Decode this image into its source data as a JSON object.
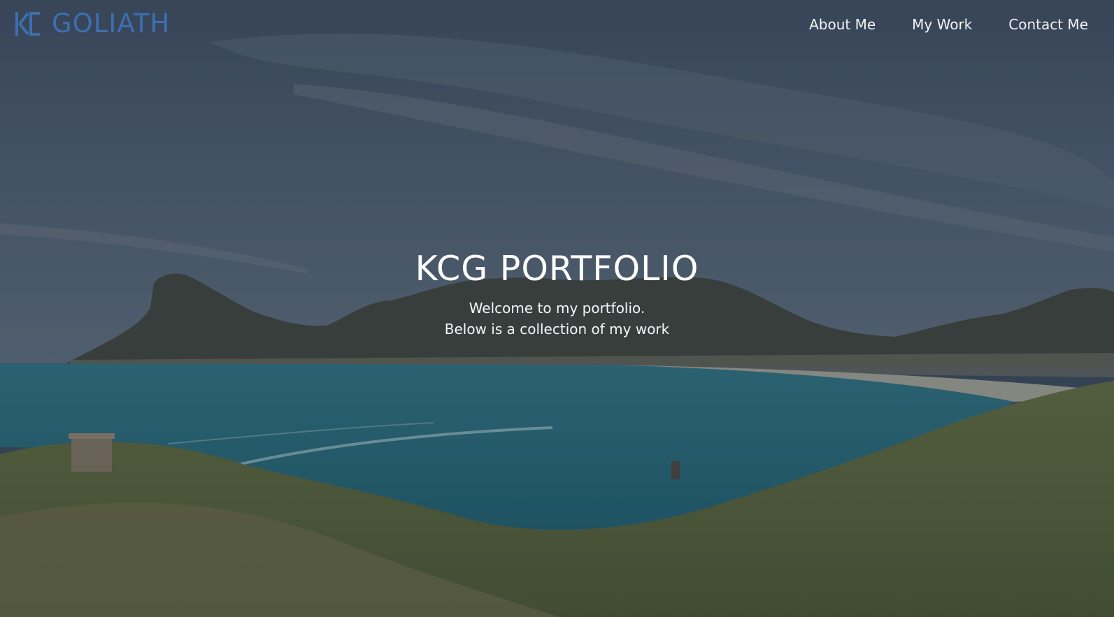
{
  "logo": {
    "text": "GOLIATH",
    "mark_icon": "kc-monogram-icon",
    "color": "#3d6fb0"
  },
  "nav": {
    "items": [
      {
        "label": "About Me"
      },
      {
        "label": "My Work"
      },
      {
        "label": "Contact Me"
      }
    ]
  },
  "hero": {
    "title": "KCG PORTFOLIO",
    "subtitle_line1": "Welcome to my portfolio.",
    "subtitle_line2": "Below is a collection of my work",
    "background": "coastal-bay-mountain-photo"
  },
  "colors": {
    "overlay": "#2b3440",
    "nav_text": "#f2f4f7",
    "title_text": "#ffffff"
  }
}
